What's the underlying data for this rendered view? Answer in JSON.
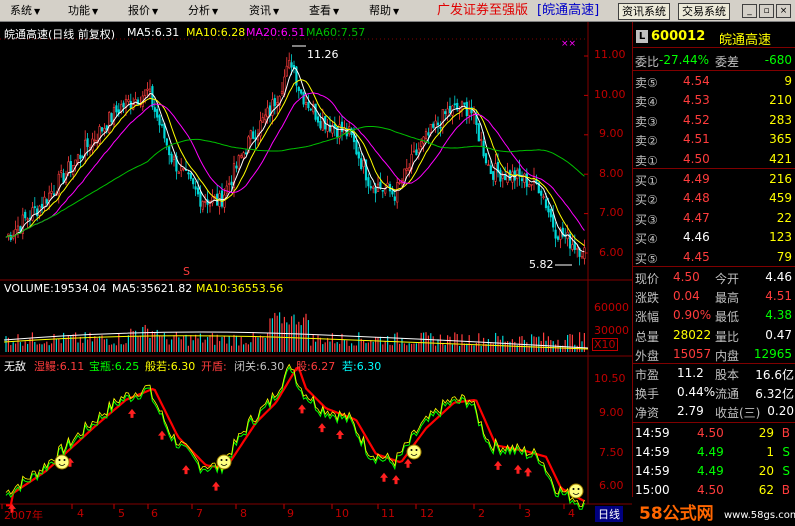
{
  "menubar": {
    "items": [
      {
        "label": "系统"
      },
      {
        "label": "功能"
      },
      {
        "label": "报价"
      },
      {
        "label": "分析"
      },
      {
        "label": "资讯"
      },
      {
        "label": "查看"
      },
      {
        "label": "帮助"
      }
    ],
    "brand": "广发证券至强版",
    "brand_stock": "[皖通高速]",
    "buttons": {
      "info_system": "资讯系统",
      "trade_system": "交易系统"
    }
  },
  "colors": {
    "ma5": "#ffffff",
    "ma10": "#ffff00",
    "ma20": "#ff00ff",
    "ma60": "#00c000",
    "up": "#ff3c3c",
    "down": "#00d7d7",
    "grid": "#800000",
    "axis": "#c00000"
  },
  "chart_header": {
    "title": "皖通高速(日线 前复权)",
    "ma5": "MA5:6.31",
    "ma10": "MA10:6.28",
    "ma20": "MA20:6.51",
    "ma60": "MA60:7.57"
  },
  "volume_header": {
    "volume": "VOLUME:19534.04",
    "ma5": "MA5:35621.82",
    "ma10": "MA10:36553.56"
  },
  "indicator_header": {
    "name": "无敌",
    "items": [
      {
        "text": "湿鳗:6.11",
        "color": "#ff3c3c"
      },
      {
        "text": "宝瓶:6.25",
        "color": "#00ff00"
      },
      {
        "text": "般若:6.30",
        "color": "#ffff00"
      },
      {
        "text": "开盾:",
        "color": "#ff3c3c"
      },
      {
        "text": "闭关:6.30",
        "color": "#c0c0c0"
      },
      {
        "text": "股:6.27",
        "color": "#ff3c3c"
      },
      {
        "text": "若:6.30",
        "color": "#00ffff"
      }
    ]
  },
  "price_axis": {
    "labels": [
      "11.00",
      "10.00",
      "9.00",
      "8.00",
      "7.00",
      "6.00"
    ],
    "values": [
      11,
      10,
      9,
      8,
      7,
      6
    ]
  },
  "volume_axis": {
    "labels": [
      "60000",
      "30000",
      "X10"
    ]
  },
  "indicator_axis": {
    "labels": [
      "10.50",
      "9.00",
      "7.50",
      "6.00"
    ],
    "values": [
      10.5,
      9,
      7.5,
      6
    ]
  },
  "annotations": {
    "high": "11.26",
    "low": "5.82",
    "s_marker": "S",
    "x_marker": "××"
  },
  "date_axis": {
    "labels": [
      "2007年",
      "4",
      "5",
      "6",
      "7",
      "8",
      "9",
      "10",
      "11",
      "12",
      "2",
      "3",
      "4"
    ],
    "period": "日线"
  },
  "quote": {
    "code": "600012",
    "name": "皖通高速",
    "badge": "L",
    "weibi_label": "委比",
    "weibi": "-27.44%",
    "weicha_label": "委差",
    "weicha": "-680",
    "sells": [
      {
        "label": "卖⑤",
        "price": "4.54",
        "vol": "9"
      },
      {
        "label": "卖④",
        "price": "4.53",
        "vol": "210"
      },
      {
        "label": "卖③",
        "price": "4.52",
        "vol": "283"
      },
      {
        "label": "卖②",
        "price": "4.51",
        "vol": "365"
      },
      {
        "label": "卖①",
        "price": "4.50",
        "vol": "421"
      }
    ],
    "buys": [
      {
        "label": "买①",
        "price": "4.49",
        "vol": "216"
      },
      {
        "label": "买②",
        "price": "4.48",
        "vol": "459"
      },
      {
        "label": "买③",
        "price": "4.47",
        "vol": "22"
      },
      {
        "label": "买④",
        "price": "4.46",
        "vol": "123"
      },
      {
        "label": "买⑤",
        "price": "4.45",
        "vol": "79"
      }
    ],
    "stats": [
      {
        "l1": "现价",
        "v1": "4.50",
        "c1": "#ff3c3c",
        "l2": "今开",
        "v2": "4.46",
        "c2": "#ffffff"
      },
      {
        "l1": "涨跌",
        "v1": "0.04",
        "c1": "#ff3c3c",
        "l2": "最高",
        "v2": "4.51",
        "c2": "#ff3c3c"
      },
      {
        "l1": "涨幅",
        "v1": "0.90%",
        "c1": "#ff3c3c",
        "l2": "最低",
        "v2": "4.38",
        "c2": "#00ff00"
      },
      {
        "l1": "总量",
        "v1": "28022",
        "c1": "#ffff00",
        "l2": "量比",
        "v2": "0.47",
        "c2": "#ffffff"
      },
      {
        "l1": "外盘",
        "v1": "15057",
        "c1": "#ff3c3c",
        "l2": "内盘",
        "v2": "12965",
        "c2": "#00ff00"
      }
    ],
    "fin": [
      {
        "l1": "市盈",
        "v1": "11.2",
        "l2": "股本",
        "v2": "16.6亿"
      },
      {
        "l1": "换手",
        "v1": "0.44%",
        "l2": "流通",
        "v2": "6.32亿"
      },
      {
        "l1": "净资",
        "v1": "2.79",
        "l2": "收益(三)",
        "v2": "0.20"
      }
    ],
    "ticks": [
      {
        "time": "14:59",
        "price": "4.50",
        "vol": "29",
        "side": "B",
        "color": "#ff3c3c"
      },
      {
        "time": "14:59",
        "price": "4.49",
        "vol": "1",
        "side": "S",
        "color": "#00ff00"
      },
      {
        "time": "14:59",
        "price": "4.49",
        "vol": "20",
        "side": "S",
        "color": "#00ff00"
      },
      {
        "time": "15:00",
        "price": "4.50",
        "vol": "62",
        "side": "B",
        "color": "#ff3c3c"
      }
    ]
  },
  "footer": {
    "logo": "58公式网",
    "url": "www.58gs.com"
  }
}
